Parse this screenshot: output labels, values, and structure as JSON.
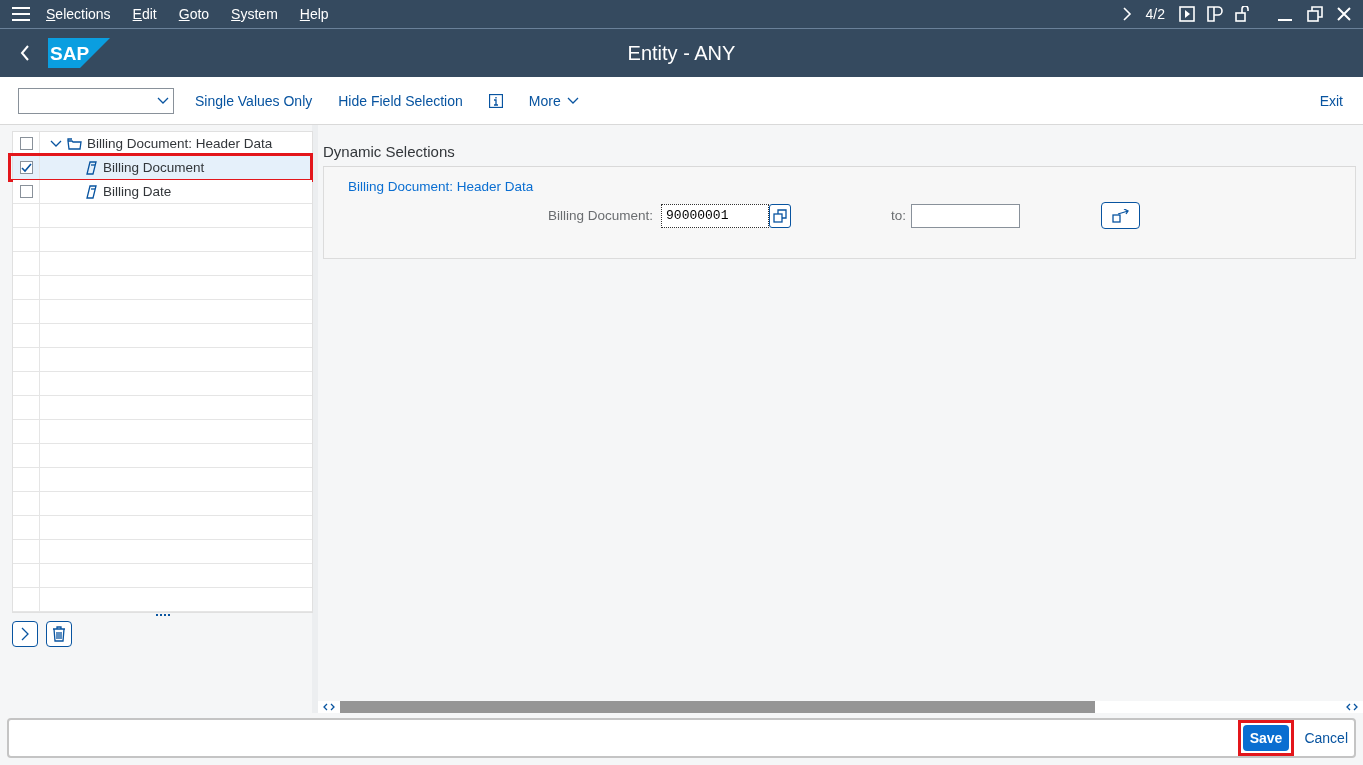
{
  "menu": [
    {
      "label": "Selections"
    },
    {
      "label": "Edit"
    },
    {
      "label": "Goto"
    },
    {
      "label": "System"
    },
    {
      "label": "Help"
    }
  ],
  "session": "4/2",
  "logo": "SAP",
  "title": "Entity - ANY",
  "toolbar": {
    "buttons": [
      "Single Values Only",
      "Hide Field Selection"
    ],
    "more": "More",
    "exit": "Exit"
  },
  "tree": [
    {
      "label": "Billing Document: Header Data",
      "checked": false,
      "expanded": true,
      "selected": false,
      "highlighted": false,
      "children": [
        {
          "label": "Billing Document",
          "checked": true,
          "selected": true,
          "highlighted": true
        },
        {
          "label": "Billing Date",
          "checked": false,
          "selected": false,
          "highlighted": false
        }
      ]
    }
  ],
  "dynamic_selections": {
    "title": "Dynamic Selections",
    "group": "Billing Document: Header Data",
    "field": {
      "label": "Billing Document:",
      "value": "90000001",
      "to_label": "to:"
    }
  },
  "footer": {
    "save": {
      "label": "Save",
      "highlighted": true
    },
    "cancel": "Cancel"
  }
}
